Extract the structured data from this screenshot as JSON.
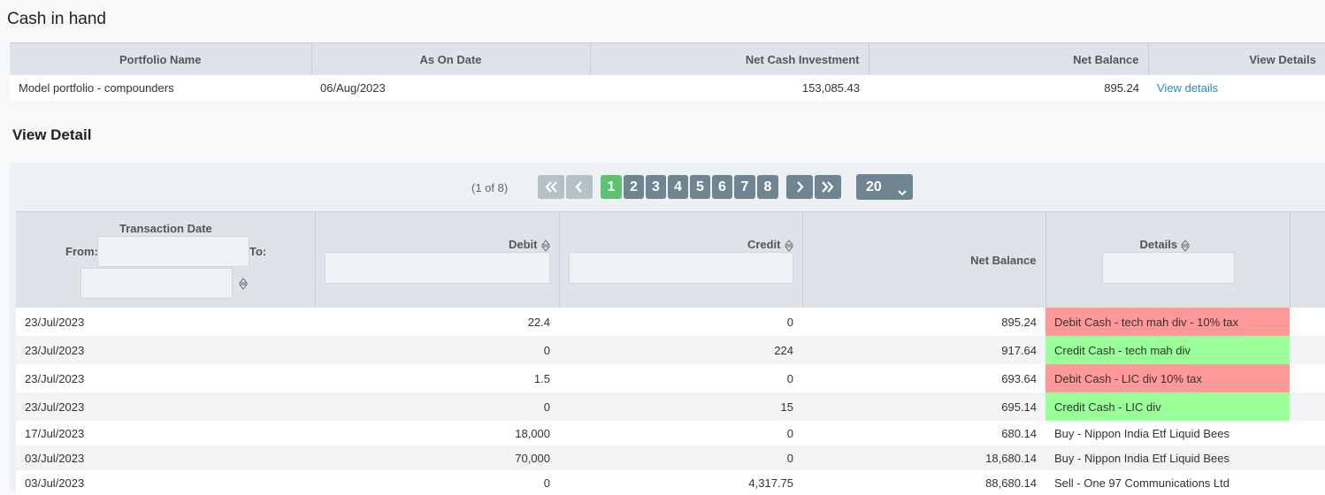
{
  "section1": {
    "title": "Cash in hand"
  },
  "summary_table": {
    "headers": [
      "Portfolio Name",
      "As On Date",
      "Net Cash Investment",
      "Net Balance",
      "View Details"
    ],
    "row": {
      "portfolio": "Model portfolio - compounders",
      "date": "06/Aug/2023",
      "net_cash_investment": "153,085.43",
      "net_balance": "895.24",
      "view_link": "View details"
    }
  },
  "section2": {
    "title": "View Detail"
  },
  "pager": {
    "info": "(1 of 8)",
    "pages": [
      "1",
      "2",
      "3",
      "4",
      "5",
      "6",
      "7",
      "8"
    ],
    "current_page": "1",
    "rows_per_page": "20"
  },
  "detail_table": {
    "headers": {
      "transaction_date": "Transaction Date",
      "from": "From:",
      "to": "To:",
      "debit": "Debit",
      "credit": "Credit",
      "net_balance": "Net Balance",
      "details": "Details"
    },
    "rows": [
      {
        "date": "23/Jul/2023",
        "debit": "22.4",
        "credit": "0",
        "net_balance": "895.24",
        "details": "Debit Cash - tech mah div - 10% tax",
        "type": "debit"
      },
      {
        "date": "23/Jul/2023",
        "debit": "0",
        "credit": "224",
        "net_balance": "917.64",
        "details": "Credit Cash - tech mah div",
        "type": "credit"
      },
      {
        "date": "23/Jul/2023",
        "debit": "1.5",
        "credit": "0",
        "net_balance": "693.64",
        "details": "Debit Cash - LIC div 10% tax",
        "type": "debit"
      },
      {
        "date": "23/Jul/2023",
        "debit": "0",
        "credit": "15",
        "net_balance": "695.14",
        "details": "Credit Cash - LIC div",
        "type": "credit"
      },
      {
        "date": "17/Jul/2023",
        "debit": "18,000",
        "credit": "0",
        "net_balance": "680.14",
        "details": "Buy - Nippon India Etf Liquid Bees",
        "type": "none"
      },
      {
        "date": "03/Jul/2023",
        "debit": "70,000",
        "credit": "0",
        "net_balance": "18,680.14",
        "details": "Buy - Nippon India Etf Liquid Bees",
        "type": "none"
      },
      {
        "date": "03/Jul/2023",
        "debit": "0",
        "credit": "4,317.75",
        "net_balance": "88,680.14",
        "details": "Sell - One 97 Communications Ltd",
        "type": "none"
      }
    ]
  },
  "colors": {
    "debit_row": "#ff9999",
    "credit_row": "#99ff99",
    "active_page": "#5cc36f",
    "link": "#2a8bc7"
  }
}
